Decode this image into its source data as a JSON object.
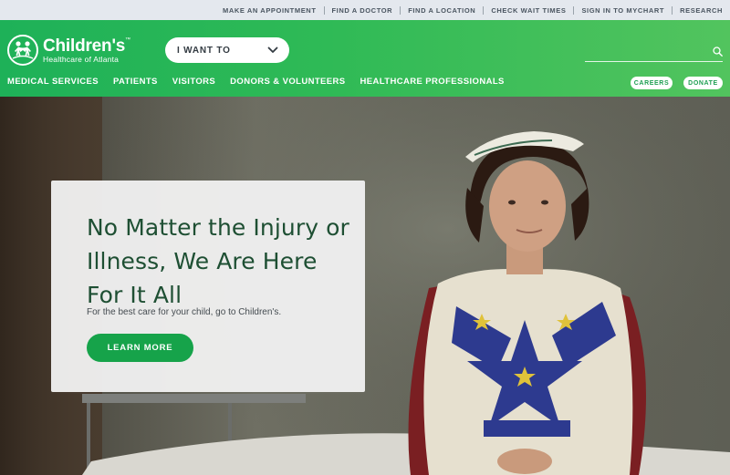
{
  "utility_links": [
    "MAKE AN APPOINTMENT",
    "FIND A DOCTOR",
    "FIND A LOCATION",
    "CHECK WAIT TIMES",
    "SIGN IN TO MYCHART",
    "RESEARCH"
  ],
  "logo": {
    "name": "Children's",
    "trademark": "™",
    "subtitle": "Healthcare of Atlanta"
  },
  "i_want": {
    "label": "I WANT TO",
    "icon": "chevron-down-icon"
  },
  "search": {
    "value": "",
    "placeholder": "",
    "icon": "search-icon"
  },
  "main_nav": [
    "MEDICAL SERVICES",
    "PATIENTS",
    "VISITORS",
    "DONORS & VOLUNTEERS",
    "HEALTHCARE PROFESSIONALS"
  ],
  "header_buttons": {
    "careers": "CAREERS",
    "donate": "DONATE"
  },
  "hero": {
    "title": "No Matter the Injury or Illness, We Are Here For It All",
    "subtitle": "For the best care for your child, go to Children's.",
    "cta": "LEARN MORE"
  },
  "colors": {
    "brand_green": "#2fba56",
    "cta_green": "#16a34a",
    "title_green": "#1e4f33",
    "utility_bar": "#e4e8ee"
  }
}
